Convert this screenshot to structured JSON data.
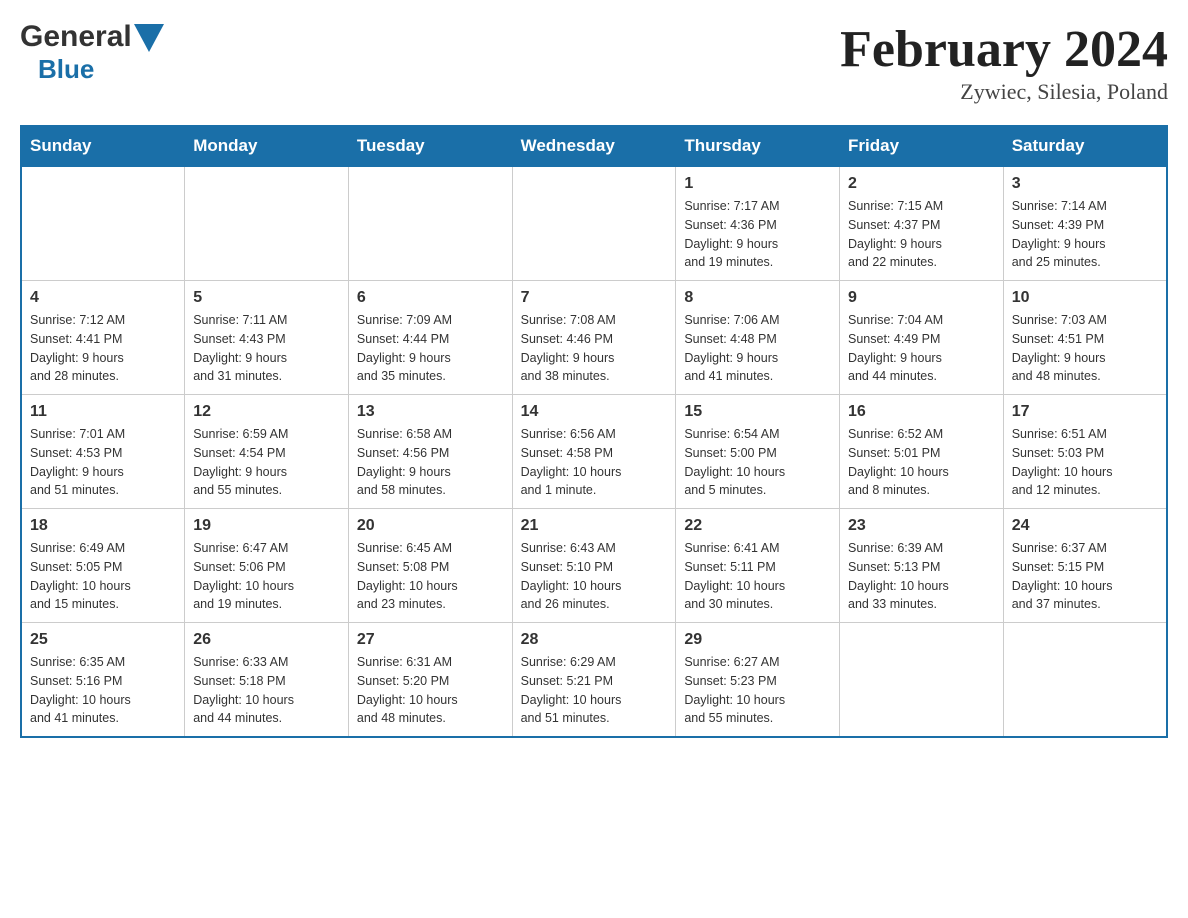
{
  "header": {
    "logo_general": "General",
    "logo_blue": "Blue",
    "month_title": "February 2024",
    "location": "Zywiec, Silesia, Poland"
  },
  "weekdays": [
    "Sunday",
    "Monday",
    "Tuesday",
    "Wednesday",
    "Thursday",
    "Friday",
    "Saturday"
  ],
  "weeks": [
    [
      {
        "day": "",
        "info": ""
      },
      {
        "day": "",
        "info": ""
      },
      {
        "day": "",
        "info": ""
      },
      {
        "day": "",
        "info": ""
      },
      {
        "day": "1",
        "info": "Sunrise: 7:17 AM\nSunset: 4:36 PM\nDaylight: 9 hours\nand 19 minutes."
      },
      {
        "day": "2",
        "info": "Sunrise: 7:15 AM\nSunset: 4:37 PM\nDaylight: 9 hours\nand 22 minutes."
      },
      {
        "day": "3",
        "info": "Sunrise: 7:14 AM\nSunset: 4:39 PM\nDaylight: 9 hours\nand 25 minutes."
      }
    ],
    [
      {
        "day": "4",
        "info": "Sunrise: 7:12 AM\nSunset: 4:41 PM\nDaylight: 9 hours\nand 28 minutes."
      },
      {
        "day": "5",
        "info": "Sunrise: 7:11 AM\nSunset: 4:43 PM\nDaylight: 9 hours\nand 31 minutes."
      },
      {
        "day": "6",
        "info": "Sunrise: 7:09 AM\nSunset: 4:44 PM\nDaylight: 9 hours\nand 35 minutes."
      },
      {
        "day": "7",
        "info": "Sunrise: 7:08 AM\nSunset: 4:46 PM\nDaylight: 9 hours\nand 38 minutes."
      },
      {
        "day": "8",
        "info": "Sunrise: 7:06 AM\nSunset: 4:48 PM\nDaylight: 9 hours\nand 41 minutes."
      },
      {
        "day": "9",
        "info": "Sunrise: 7:04 AM\nSunset: 4:49 PM\nDaylight: 9 hours\nand 44 minutes."
      },
      {
        "day": "10",
        "info": "Sunrise: 7:03 AM\nSunset: 4:51 PM\nDaylight: 9 hours\nand 48 minutes."
      }
    ],
    [
      {
        "day": "11",
        "info": "Sunrise: 7:01 AM\nSunset: 4:53 PM\nDaylight: 9 hours\nand 51 minutes."
      },
      {
        "day": "12",
        "info": "Sunrise: 6:59 AM\nSunset: 4:54 PM\nDaylight: 9 hours\nand 55 minutes."
      },
      {
        "day": "13",
        "info": "Sunrise: 6:58 AM\nSunset: 4:56 PM\nDaylight: 9 hours\nand 58 minutes."
      },
      {
        "day": "14",
        "info": "Sunrise: 6:56 AM\nSunset: 4:58 PM\nDaylight: 10 hours\nand 1 minute."
      },
      {
        "day": "15",
        "info": "Sunrise: 6:54 AM\nSunset: 5:00 PM\nDaylight: 10 hours\nand 5 minutes."
      },
      {
        "day": "16",
        "info": "Sunrise: 6:52 AM\nSunset: 5:01 PM\nDaylight: 10 hours\nand 8 minutes."
      },
      {
        "day": "17",
        "info": "Sunrise: 6:51 AM\nSunset: 5:03 PM\nDaylight: 10 hours\nand 12 minutes."
      }
    ],
    [
      {
        "day": "18",
        "info": "Sunrise: 6:49 AM\nSunset: 5:05 PM\nDaylight: 10 hours\nand 15 minutes."
      },
      {
        "day": "19",
        "info": "Sunrise: 6:47 AM\nSunset: 5:06 PM\nDaylight: 10 hours\nand 19 minutes."
      },
      {
        "day": "20",
        "info": "Sunrise: 6:45 AM\nSunset: 5:08 PM\nDaylight: 10 hours\nand 23 minutes."
      },
      {
        "day": "21",
        "info": "Sunrise: 6:43 AM\nSunset: 5:10 PM\nDaylight: 10 hours\nand 26 minutes."
      },
      {
        "day": "22",
        "info": "Sunrise: 6:41 AM\nSunset: 5:11 PM\nDaylight: 10 hours\nand 30 minutes."
      },
      {
        "day": "23",
        "info": "Sunrise: 6:39 AM\nSunset: 5:13 PM\nDaylight: 10 hours\nand 33 minutes."
      },
      {
        "day": "24",
        "info": "Sunrise: 6:37 AM\nSunset: 5:15 PM\nDaylight: 10 hours\nand 37 minutes."
      }
    ],
    [
      {
        "day": "25",
        "info": "Sunrise: 6:35 AM\nSunset: 5:16 PM\nDaylight: 10 hours\nand 41 minutes."
      },
      {
        "day": "26",
        "info": "Sunrise: 6:33 AM\nSunset: 5:18 PM\nDaylight: 10 hours\nand 44 minutes."
      },
      {
        "day": "27",
        "info": "Sunrise: 6:31 AM\nSunset: 5:20 PM\nDaylight: 10 hours\nand 48 minutes."
      },
      {
        "day": "28",
        "info": "Sunrise: 6:29 AM\nSunset: 5:21 PM\nDaylight: 10 hours\nand 51 minutes."
      },
      {
        "day": "29",
        "info": "Sunrise: 6:27 AM\nSunset: 5:23 PM\nDaylight: 10 hours\nand 55 minutes."
      },
      {
        "day": "",
        "info": ""
      },
      {
        "day": "",
        "info": ""
      }
    ]
  ]
}
